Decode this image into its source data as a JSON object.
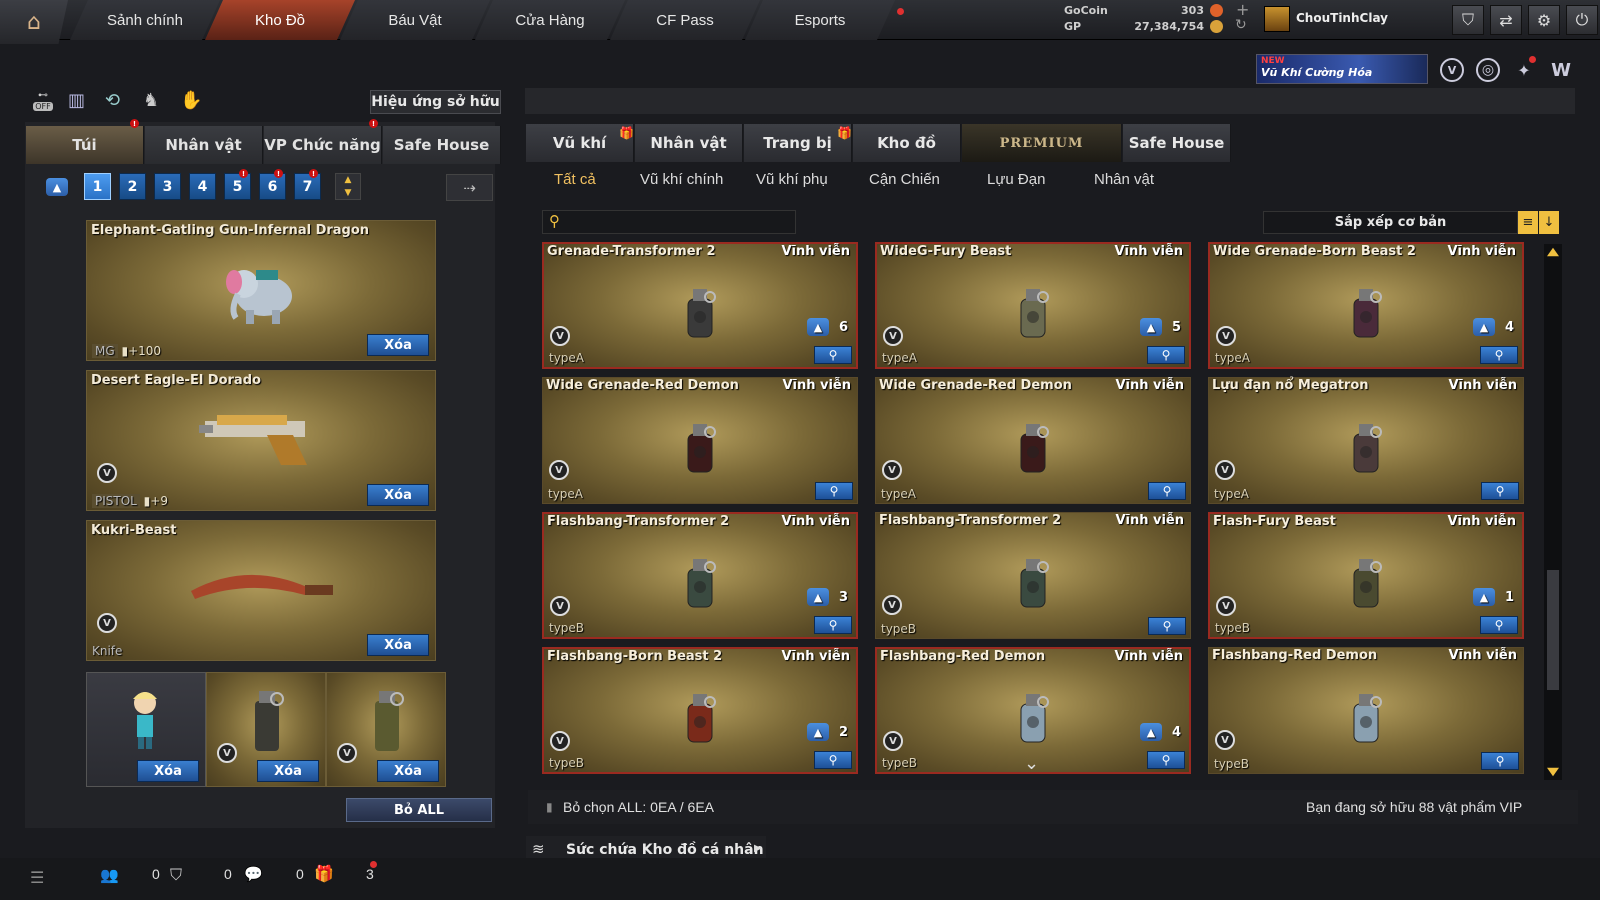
{
  "nav": {
    "tabs": [
      "Sảnh chính",
      "Kho Đồ",
      "Báu Vật",
      "Cửa Hàng",
      "CF Pass",
      "Esports"
    ],
    "active": 1
  },
  "currency": {
    "gocoin_label": "GoCoin",
    "gocoin_value": "303",
    "gp_label": "GP",
    "gp_value": "27,384,754"
  },
  "user": {
    "name": "ChouTinhClay"
  },
  "banner": {
    "new": "NEW",
    "text": "Vũ Khí Cường Hóa"
  },
  "left": {
    "effect_button": "Hiệu ứng sở hữu",
    "toggle_label": "OFF",
    "tabs": [
      "Túi",
      "Nhân vật",
      "VP Chức năng",
      "Safe House"
    ],
    "pages": [
      "1",
      "2",
      "3",
      "4",
      "5",
      "6",
      "7"
    ],
    "slots": [
      {
        "name": "Elephant-Gatling Gun-Infernal Dragon",
        "type": "MG",
        "bonus": "+100",
        "delete": "Xóa"
      },
      {
        "name": "Desert Eagle-El Dorado",
        "type": "PISTOL",
        "bonus": "+9",
        "delete": "Xóa"
      },
      {
        "name": "Kukri-Beast",
        "type": "Knife",
        "bonus": "",
        "delete": "Xóa"
      }
    ],
    "mini_slots": [
      {
        "delete": "Xóa"
      },
      {
        "delete": "Xóa"
      },
      {
        "delete": "Xóa"
      }
    ],
    "remove_all": "Bỏ ALL"
  },
  "right": {
    "tabs": [
      "Vũ khí",
      "Nhân vật",
      "Trang bị",
      "Kho đồ",
      "PREMIUM",
      "Safe House"
    ],
    "subtabs": [
      "Tất cả",
      "Vũ khí chính",
      "Vũ khí phụ",
      "Cận Chiến",
      "Lựu Đạn",
      "Nhân vật"
    ],
    "search_placeholder": "",
    "sort_label": "Sắp xếp cơ bản",
    "items": [
      {
        "name": "Grenade-Transformer 2",
        "expiry": "Vĩnh viễn",
        "type": "typeA",
        "count": "6",
        "red": true
      },
      {
        "name": "WideG-Fury Beast",
        "expiry": "Vĩnh viễn",
        "type": "typeA",
        "count": "5",
        "red": true
      },
      {
        "name": "Wide Grenade-Born Beast 2",
        "expiry": "Vĩnh viễn",
        "type": "typeA",
        "count": "4",
        "red": true
      },
      {
        "name": "Wide Grenade-Red Demon",
        "expiry": "Vĩnh viễn",
        "type": "typeA",
        "count": "",
        "red": false
      },
      {
        "name": "Wide Grenade-Red Demon",
        "expiry": "Vĩnh viễn",
        "type": "typeA",
        "count": "",
        "red": false
      },
      {
        "name": "Lựu đạn nổ Megatron",
        "expiry": "Vĩnh viễn",
        "type": "typeA",
        "count": "",
        "red": false
      },
      {
        "name": "Flashbang-Transformer 2",
        "expiry": "Vĩnh viễn",
        "type": "typeB",
        "count": "3",
        "red": true
      },
      {
        "name": "Flashbang-Transformer 2",
        "expiry": "Vĩnh viễn",
        "type": "typeB",
        "count": "",
        "red": false
      },
      {
        "name": "Flash-Fury Beast",
        "expiry": "Vĩnh viễn",
        "type": "typeB",
        "count": "1",
        "red": true
      },
      {
        "name": "Flashbang-Born Beast 2",
        "expiry": "Vĩnh viễn",
        "type": "typeB",
        "count": "2",
        "red": true
      },
      {
        "name": "Flashbang-Red Demon",
        "expiry": "Vĩnh viễn",
        "type": "typeB",
        "count": "4",
        "red": true
      },
      {
        "name": "Flashbang-Red Demon",
        "expiry": "Vĩnh viễn",
        "type": "typeB",
        "count": "",
        "red": false
      }
    ],
    "deselect": "Bỏ chọn ALL: 0EA / 6EA",
    "vip_info": "Bạn đang sở hữu 88 vật phẩm VIP",
    "capacity": "Sức chứa Kho đồ cá nhân"
  },
  "bottom": {
    "friends": "0",
    "clan": "0",
    "chat": "0",
    "gifts": "3"
  }
}
